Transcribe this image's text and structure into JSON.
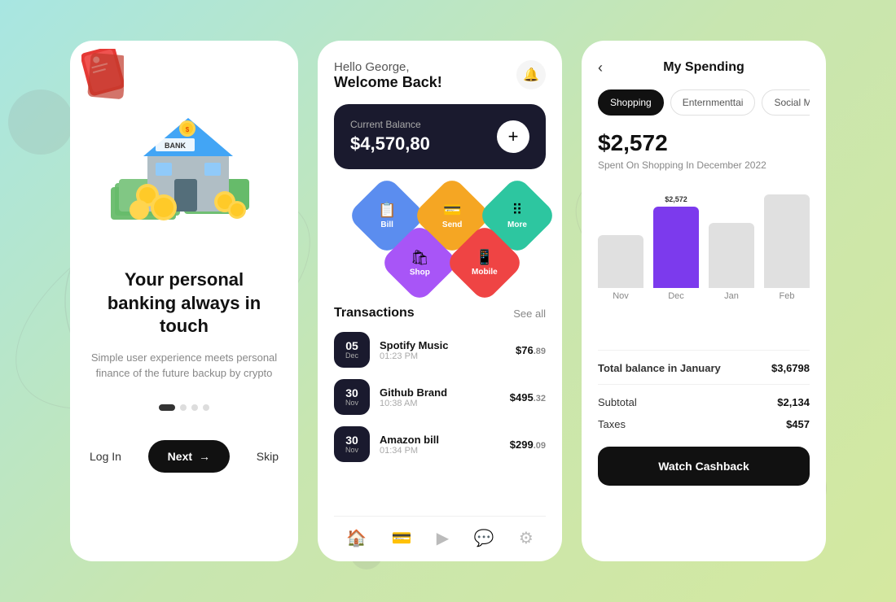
{
  "background": {
    "gradient_start": "#a8e6e2",
    "gradient_end": "#d4e8a0"
  },
  "card1": {
    "title": "Your personal banking always in touch",
    "subtitle": "Simple user experience meets personal finance of the future backup by crypto",
    "btn_login": "Log In",
    "btn_next": "Next",
    "btn_skip": "Skip",
    "dots": [
      "active",
      "inactive",
      "inactive",
      "inactive"
    ]
  },
  "card2": {
    "greeting": "Hello George,",
    "welcome": "Welcome Back!",
    "balance_label": "Current Balance",
    "balance_amount": "$4,570,80",
    "actions": [
      {
        "label": "Bill",
        "color": "#5b8def",
        "icon": "📋"
      },
      {
        "label": "Send",
        "color": "#f5a623",
        "icon": "💸"
      },
      {
        "label": "More",
        "color": "#2dc6a0",
        "icon": "⠿"
      },
      {
        "label": "Shop",
        "color": "#a855f7",
        "icon": "🛍"
      },
      {
        "label": "Mobile",
        "color": "#ef4444",
        "icon": "📱"
      }
    ],
    "transactions_title": "Transactions",
    "see_all": "See all",
    "transactions": [
      {
        "day": "05",
        "month": "Dec",
        "name": "Spotify Music",
        "time": "01:23 PM",
        "amount": "$76",
        "cents": ".89"
      },
      {
        "day": "30",
        "month": "Nov",
        "name": "Github Brand",
        "time": "10:38 AM",
        "amount": "$495",
        "cents": ".32"
      },
      {
        "day": "30",
        "month": "Nov",
        "name": "Amazon bill",
        "time": "01:34 PM",
        "amount": "$299",
        "cents": ".09"
      }
    ]
  },
  "card3": {
    "title": "My Spending",
    "back_label": "‹",
    "categories": [
      "Shopping",
      "Enternmenttai",
      "Social Mec"
    ],
    "active_category": "Shopping",
    "amount": "$2,572",
    "description": "Spent On Shopping In December 2022",
    "chart": {
      "bars": [
        {
          "month": "Nov",
          "height": 65,
          "value": "",
          "color": "#e0e0e0"
        },
        {
          "month": "Dec",
          "height": 110,
          "value": "$2,572",
          "color": "#7c3aed"
        },
        {
          "month": "Jan",
          "height": 88,
          "value": "",
          "color": "#e0e0e0"
        },
        {
          "month": "Feb",
          "height": 120,
          "value": "",
          "color": "#e0e0e0"
        }
      ]
    },
    "summary": [
      {
        "label": "Total balance in January",
        "value": "$3,6798",
        "bold": true
      },
      {
        "label": "Subtotal",
        "value": "$2,134"
      },
      {
        "label": "Taxes",
        "value": "$457"
      }
    ],
    "watch_btn": "Watch Cashback"
  }
}
